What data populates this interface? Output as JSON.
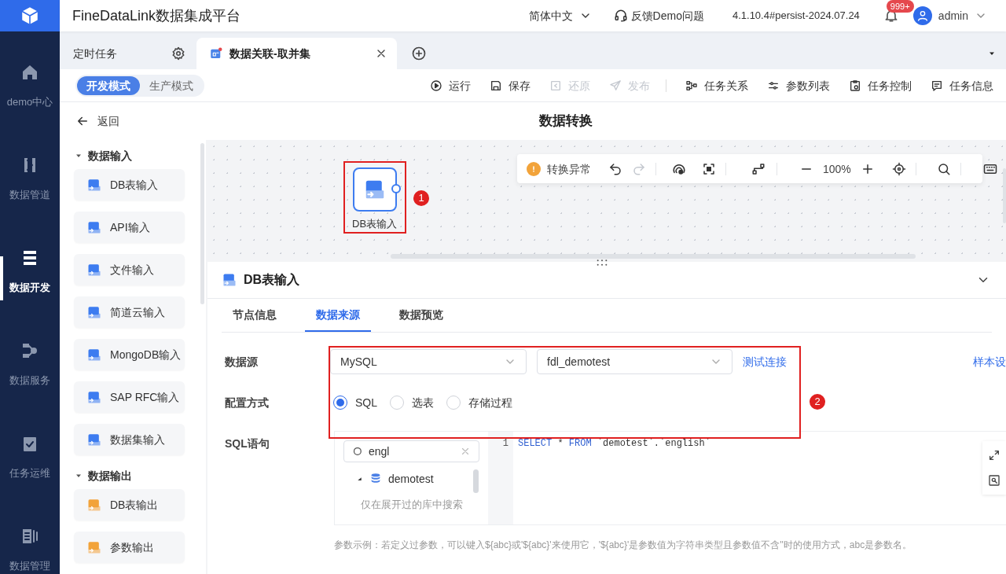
{
  "nav": {
    "items": [
      {
        "label": "demo中心",
        "kind": "home",
        "selected": false
      },
      {
        "label": "数据管道",
        "kind": "pipeline",
        "selected": false
      },
      {
        "label": "数据开发",
        "kind": "dev",
        "selected": true
      },
      {
        "label": "数据服务",
        "kind": "service",
        "selected": false
      },
      {
        "label": "任务运维",
        "kind": "ops",
        "selected": false
      },
      {
        "label": "数据管理",
        "kind": "manage",
        "selected": false
      }
    ]
  },
  "header": {
    "title": "FineDataLink数据集成平台",
    "language": "简体中文",
    "feedback": "反馈Demo问题",
    "version": "4.1.10.4#persist-2024.07.24",
    "notification_count": "999+",
    "user": "admin"
  },
  "tabs": [
    {
      "label": "定时任务",
      "kind": "folder",
      "selected": false
    },
    {
      "label": "数据关联-取并集",
      "kind": "task",
      "selected": true
    }
  ],
  "modes": [
    {
      "label": "开发模式",
      "selected": true
    },
    {
      "label": "生产模式",
      "selected": false
    }
  ],
  "actions": [
    {
      "label": "运行",
      "kind": "run",
      "disabled": false
    },
    {
      "label": "保存",
      "kind": "save",
      "disabled": false
    },
    {
      "label": "还原",
      "kind": "restore",
      "disabled": true
    },
    {
      "label": "发布",
      "kind": "publish",
      "disabled": true
    },
    {
      "label": "任务关系",
      "kind": "relation",
      "disabled": false
    },
    {
      "label": "参数列表",
      "kind": "params",
      "disabled": false
    },
    {
      "label": "任务控制",
      "kind": "control",
      "disabled": false
    },
    {
      "label": "任务信息",
      "kind": "info",
      "disabled": false
    }
  ],
  "back": "返回",
  "page_title": "数据转换",
  "palette": {
    "groups": [
      {
        "label": "数据输入",
        "kind": "input",
        "expanded": true,
        "items": [
          {
            "label": "DB表输入"
          },
          {
            "label": "API输入"
          },
          {
            "label": "文件输入"
          },
          {
            "label": "简道云输入"
          },
          {
            "label": "MongoDB输入"
          },
          {
            "label": "SAP RFC输入"
          },
          {
            "label": "数据集输入"
          }
        ]
      },
      {
        "label": "数据输出",
        "kind": "output",
        "expanded": true,
        "items": [
          {
            "label": "DB表输出"
          },
          {
            "label": "参数输出"
          }
        ]
      }
    ]
  },
  "canvas": {
    "status": "转换异常",
    "zoom": "100%",
    "node": {
      "label": "DB表输入",
      "annotation": "1"
    }
  },
  "panel": {
    "title": "DB表输入",
    "expanded": true,
    "tabs": [
      {
        "label": "节点信息",
        "selected": false
      },
      {
        "label": "数据来源",
        "selected": true
      },
      {
        "label": "数据预览",
        "selected": false
      }
    ],
    "datasource": {
      "label": "数据源",
      "type": "MySQL",
      "connection": "fdl_demotest",
      "test_link": "测试连接",
      "sample_link": "样本设"
    },
    "config": {
      "label": "配置方式",
      "options": [
        {
          "label": "SQL",
          "selected": true
        },
        {
          "label": "选表",
          "selected": false
        },
        {
          "label": "存储过程",
          "selected": false
        }
      ]
    },
    "sql": {
      "label": "SQL语句",
      "search": "engl",
      "tree": [
        {
          "label": "demotest",
          "expanded": true
        }
      ],
      "tree_hint": "仅在展开过的库中搜索",
      "line_number": "1",
      "code": [
        {
          "text": "SELECT",
          "kind": "keyword"
        },
        {
          "text": " * ",
          "kind": "plain"
        },
        {
          "text": "FROM",
          "kind": "keyword"
        },
        {
          "text": " `demotest`.`english`",
          "kind": "plain"
        }
      ]
    },
    "hint": "参数示例：若定义过参数，可以键入${abc}或'${abc}'来使用它，'${abc}'是参数值为字符串类型且参数值不含''时的使用方式，abc是参数名。",
    "annotation": "2"
  }
}
